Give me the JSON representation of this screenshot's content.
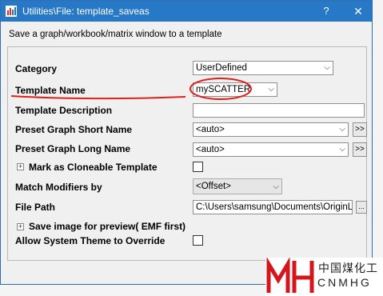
{
  "window": {
    "title": "Utilities\\File: template_saveas",
    "help_label": "?",
    "close_label": "✕",
    "description": "Save a graph/workbook/matrix window to a template"
  },
  "form": {
    "category_label": "Category",
    "category_value": "UserDefined",
    "template_name_label": "Template Name",
    "template_name_value": "mySCATTER",
    "template_description_label": "Template Description",
    "template_description_value": "",
    "preset_short_label": "Preset Graph Short Name",
    "preset_short_value": "<auto>",
    "preset_long_label": "Preset Graph Long Name",
    "preset_long_value": "<auto>",
    "cloneable_label": "Mark as Cloneable Template",
    "cloneable_checked": false,
    "match_modifiers_label": "Match Modifiers by",
    "match_modifiers_value": "<Offset>",
    "file_path_label": "File Path",
    "file_path_value": "C:\\Users\\samsung\\Documents\\OriginLa",
    "save_image_label": "Save image for preview( EMF first)",
    "allow_theme_label": "Allow System Theme to Override",
    "allow_theme_checked": false,
    "expand_button_label": ">>",
    "browse_button_label": "...",
    "dropdown_glyph": "⌵"
  },
  "watermark": {
    "text_cn": "中国煤化工",
    "text_en": "CNMHG",
    "colors": {
      "red": "#d4161c",
      "dark": "#222222"
    }
  },
  "colors": {
    "titlebar": "#2878c8",
    "annotation": "#e0201c"
  }
}
